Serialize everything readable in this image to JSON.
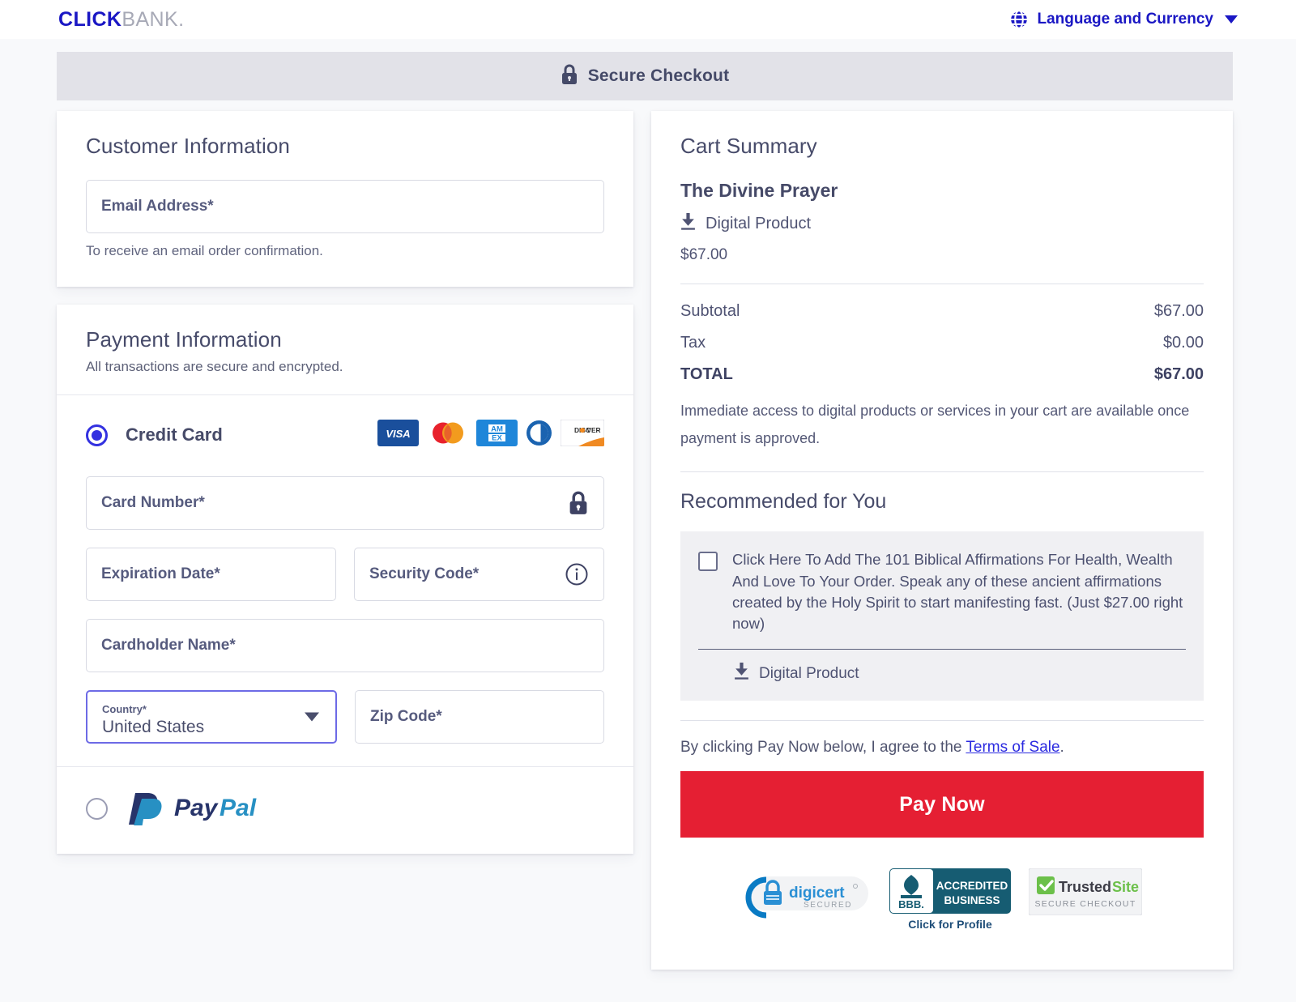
{
  "brand": {
    "logo_bold": "CLICK",
    "logo_light": "BANK."
  },
  "header": {
    "language_label": "Language and Currency",
    "secure_checkout": "Secure Checkout"
  },
  "customer": {
    "title": "Customer Information",
    "email_placeholder": "Email Address*",
    "helper": "To receive an email order confirmation."
  },
  "payment": {
    "title": "Payment Information",
    "subtitle": "All transactions are secure and encrypted.",
    "credit_card_label": "Credit Card",
    "card_brands": [
      "visa",
      "mastercard",
      "amex",
      "diners-club",
      "discover"
    ],
    "card_number_placeholder": "Card Number*",
    "expiration_placeholder": "Expiration Date*",
    "security_code_placeholder": "Security Code*",
    "cardholder_placeholder": "Cardholder Name*",
    "country_label": "Country*",
    "country_value": "United States",
    "zip_placeholder": "Zip Code*",
    "paypal_label": "PayPal"
  },
  "cart": {
    "title": "Cart Summary",
    "product_name": "The Divine Prayer",
    "product_type": "Digital Product",
    "product_price": "$67.00",
    "rows": [
      {
        "label": "Subtotal",
        "value": "$67.00"
      },
      {
        "label": "Tax",
        "value": "$0.00"
      },
      {
        "label": "TOTAL",
        "value": "$67.00"
      }
    ],
    "note": "Immediate access to digital products or services in your cart are available once payment is approved."
  },
  "recommended": {
    "title": "Recommended for You",
    "offer_text": "Click Here To Add The 101 Biblical Affirmations For Health, Wealth And Love To Your Order. Speak any of these ancient affirmations created by the Holy Spirit to start manifesting fast. (Just $27.00 right now)",
    "offer_type": "Digital Product"
  },
  "footer": {
    "terms_prefix": "By clicking Pay Now below, I agree to the ",
    "terms_link": "Terms of Sale",
    "terms_suffix": ".",
    "pay_button": "Pay Now",
    "badges": {
      "digicert_name": "digicert",
      "digicert_sub": "SECURED",
      "bbb_line1": "ACCREDITED",
      "bbb_line2": "BUSINESS",
      "bbb_abbr": "BBB.",
      "bbb_click": "Click for Profile",
      "trusted_name_1": "Trusted",
      "trusted_name_2": "Site",
      "trusted_sub": "SECURE CHECKOUT"
    }
  },
  "colors": {
    "brand_blue": "#1a17c4",
    "radio_blue": "#3331e0",
    "pay_red": "#e51f33",
    "band_gray": "#e2e2e8",
    "text": "#4c4f6b"
  }
}
